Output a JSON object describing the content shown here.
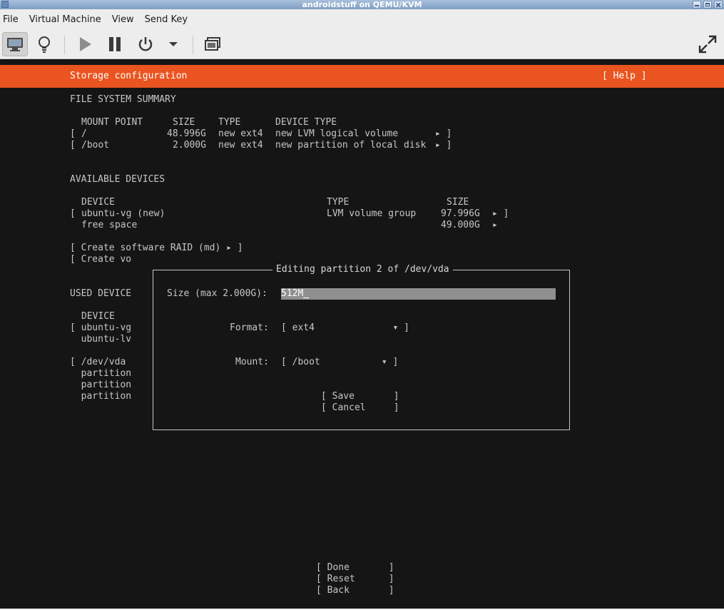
{
  "window": {
    "title": "androidstuff on QEMU/KVM"
  },
  "menu": [
    "File",
    "Virtual Machine",
    "View",
    "Send Key"
  ],
  "toolbar": {
    "icons": [
      "console-icon",
      "bulb-icon",
      "play-icon",
      "pause-icon",
      "power-icon",
      "dropdown-icon",
      "snapshot-icon",
      "fullscreen-icon"
    ]
  },
  "installer": {
    "header": {
      "title": "Storage configuration",
      "help": "[ Help ]"
    },
    "fs_summary": {
      "heading": "FILE SYSTEM SUMMARY",
      "columns": [
        "MOUNT POINT",
        "SIZE",
        "TYPE",
        "DEVICE TYPE"
      ],
      "rows": [
        {
          "open": "[",
          "mount": "/",
          "size": "48.996G",
          "type": "new ext4",
          "device_type": "new LVM logical volume",
          "arrow": "▸ ]"
        },
        {
          "open": "[",
          "mount": "/boot",
          "size": "2.000G",
          "type": "new ext4",
          "device_type": "new partition of local disk",
          "arrow": "▸ ]"
        }
      ]
    },
    "available": {
      "heading": "AVAILABLE DEVICES",
      "columns": [
        "DEVICE",
        "TYPE",
        "SIZE"
      ],
      "rows": [
        {
          "open": "[",
          "device": "ubuntu-vg (new)",
          "type": "LVM volume group",
          "size": "97.996G",
          "arrow": "▸ ]"
        },
        {
          "open": "",
          "device": "free space",
          "type": "",
          "size": "49.000G",
          "arrow": "▸"
        }
      ],
      "actions": [
        "[ Create software RAID (md) ▸ ]",
        "[ Create vo"
      ]
    },
    "used": {
      "heading": "USED DEVICE",
      "column": "DEVICE",
      "lines": [
        "[ ubuntu-vg",
        "  ubuntu-lv",
        "[ /dev/vda",
        "  partition",
        "  partition",
        "  partition"
      ]
    },
    "dialog": {
      "title": "Editing partition 2 of /dev/vda",
      "size_label": "Size (max 2.000G):",
      "size_value": "512M",
      "format_label": "Format:",
      "format_value": "[ ext4              ▾ ]",
      "mount_label": "Mount:",
      "mount_value": "[ /boot           ▾ ]",
      "save": "[ Save       ]",
      "cancel": "[ Cancel     ]"
    },
    "footer": {
      "done": "[ Done       ]",
      "reset": "[ Reset      ]",
      "back": "[ Back       ]"
    }
  },
  "colors": {
    "header": "#e95420",
    "console_bg": "#151515",
    "console_text": "#c6c6c6",
    "input_bg": "#8f8f8f"
  }
}
